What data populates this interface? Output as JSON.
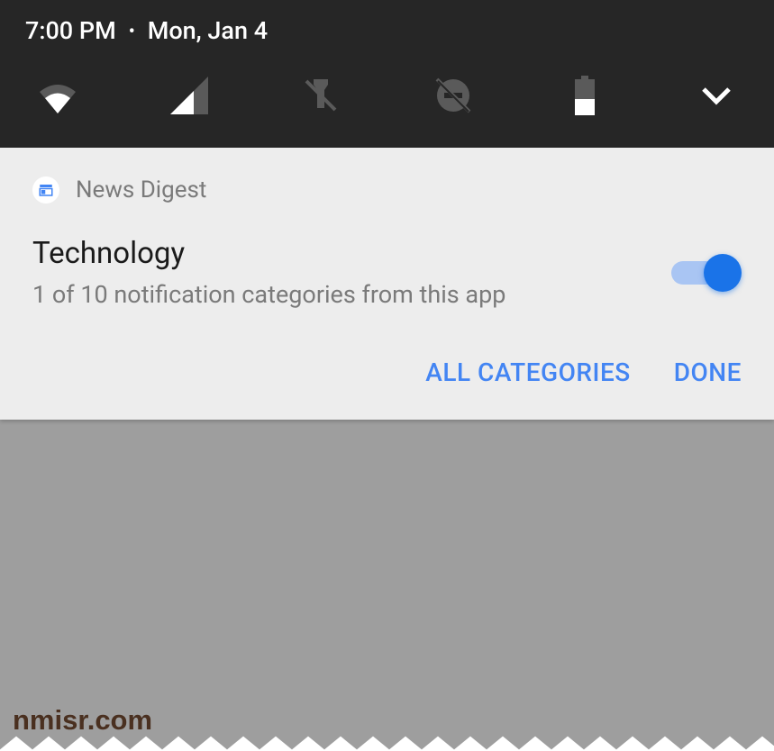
{
  "status_bar": {
    "time": "7:00 PM",
    "date": "Mon, Jan 4"
  },
  "notification": {
    "app_name": "News Digest",
    "title": "Technology",
    "subtitle": "1 of 10 notification categories from this app",
    "toggle_on": true
  },
  "actions": {
    "all_categories": "ALL CATEGORIES",
    "done": "DONE"
  },
  "watermark": "nmisr.com"
}
